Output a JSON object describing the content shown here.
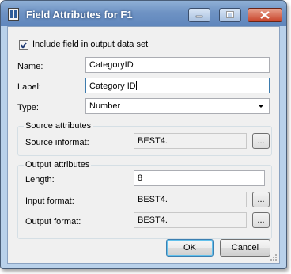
{
  "window": {
    "title": "Field Attributes for F1"
  },
  "include": {
    "label": "Include field in output data set",
    "checked": true
  },
  "name": {
    "label": "Name:",
    "value": "CategoryID"
  },
  "label_field": {
    "label": "Label:",
    "value": "Category ID"
  },
  "type": {
    "label": "Type:",
    "value": "Number"
  },
  "source": {
    "title": "Source attributes",
    "informat_label": "Source informat:",
    "informat_value": "BEST4.",
    "browse": "..."
  },
  "output": {
    "title": "Output attributes",
    "length_label": "Length:",
    "length_value": "8",
    "input_format_label": "Input format:",
    "input_format_value": "BEST4.",
    "output_format_label": "Output format:",
    "output_format_value": "BEST4.",
    "browse": "..."
  },
  "buttons": {
    "ok": "OK",
    "cancel": "Cancel"
  },
  "colors": {
    "titlebar": "#6f93c4",
    "client": "#f0f0f0",
    "close": "#c8442a"
  }
}
